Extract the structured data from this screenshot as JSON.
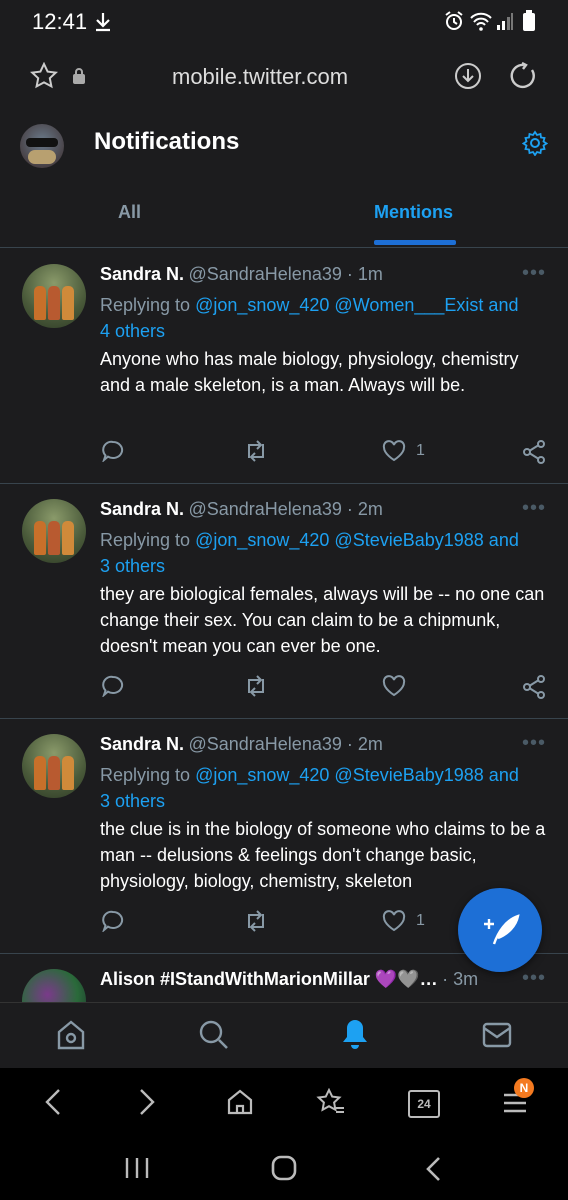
{
  "status_bar": {
    "time": "12:41"
  },
  "url_bar": {
    "url": "mobile.twitter.com"
  },
  "header": {
    "title": "Notifications"
  },
  "tabs": [
    {
      "label": "All"
    },
    {
      "label": "Mentions"
    }
  ],
  "tweets": [
    {
      "name": "Sandra N.",
      "handle": "@SandraHelena39 · 1m",
      "replying_prefix": "Replying to ",
      "replying_links_line1": "@jon_snow_420 @Women___Exist and",
      "replying_links_line2": "4 others",
      "text": "Anyone who has male biology, physiology, chemistry and a male skeleton, is a man. Always will be.",
      "likes": "1"
    },
    {
      "name": "Sandra N.",
      "handle": "@SandraHelena39 · 2m",
      "replying_prefix": "Replying to ",
      "replying_links_line1": "@jon_snow_420 @StevieBaby1988 and",
      "replying_links_line2": "3 others",
      "text": "they are biological females, always will be -- no one can change their sex. You can claim to be a chipmunk, doesn't mean you can ever be one.",
      "likes": ""
    },
    {
      "name": "Sandra N.",
      "handle": "@SandraHelena39 · 2m",
      "replying_prefix": "Replying to ",
      "replying_links_line1": "@jon_snow_420 @StevieBaby1988 and",
      "replying_links_line2": "3 others",
      "text": "the clue is in the biology of someone who claims to be a man -- delusions & feelings don't change basic, physiology, biology, chemistry, skeleton",
      "likes": "1"
    },
    {
      "name": "Alison #IStandWithMarionMillar 💜🩶…",
      "handle": "· 3m"
    }
  ],
  "browser_bar": {
    "tabs_count": "24",
    "badge": "N"
  },
  "colors": {
    "accent": "#1da1f2",
    "bg": "#1c1c1e",
    "muted": "#8899a6",
    "fab": "#1d6fd6"
  }
}
